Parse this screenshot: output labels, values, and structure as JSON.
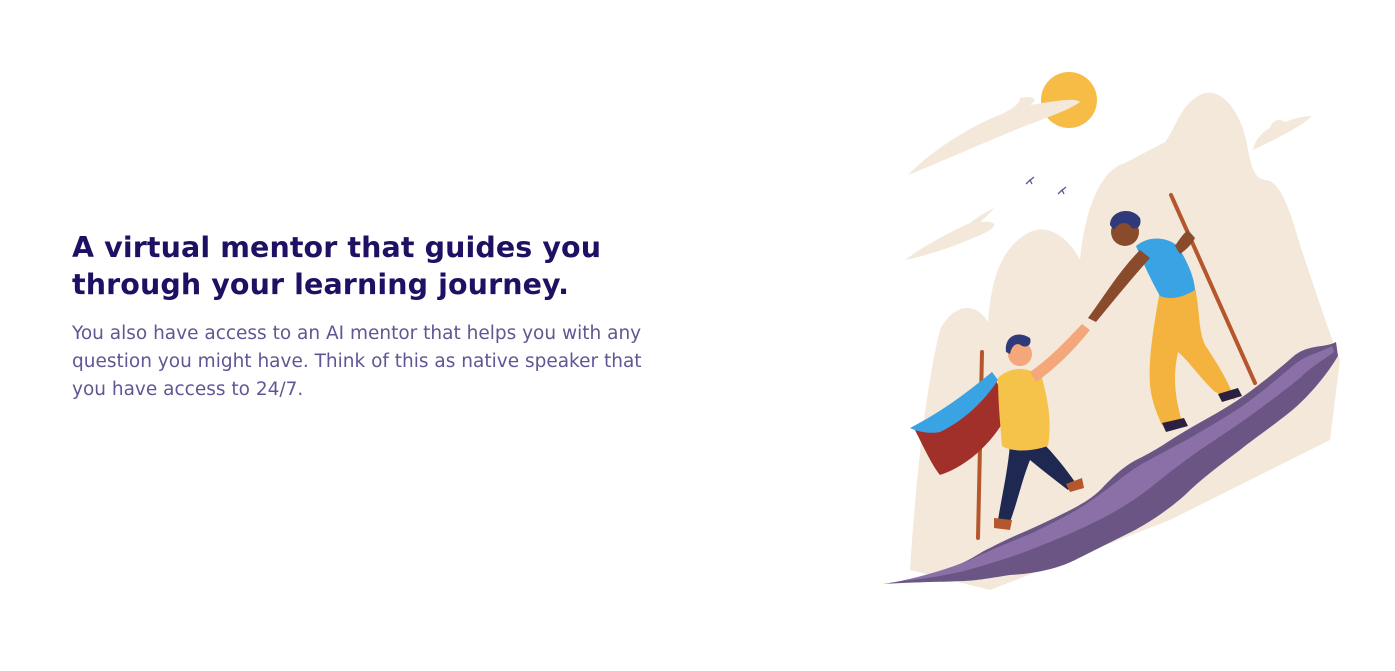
{
  "feature": {
    "heading": "A virtual mentor that guides you through your learning journey.",
    "description": "You also have access to an AI mentor that helps you with any question you might have. Think of this as native speaker that you have access to 24/7."
  },
  "illustration": {
    "subject": "hikers-helping-climb-mountain-illustration",
    "colors": {
      "sun": "#f6bc45",
      "mountain": "#f3e8da",
      "rock": "#6a5585",
      "rock_light": "#8a70a6",
      "heading_text": "#1f1063",
      "body_text": "#5f5793"
    }
  }
}
